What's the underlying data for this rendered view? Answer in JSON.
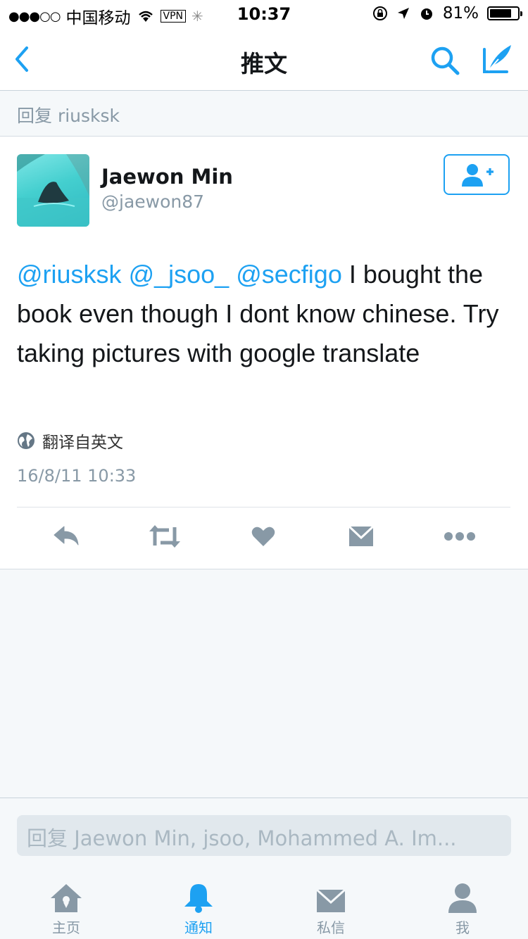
{
  "status_bar": {
    "signal": "●●●○○",
    "carrier": "中国移动",
    "vpn": "VPN",
    "time": "10:37",
    "battery_text": "81%",
    "battery_level": 0.81
  },
  "nav": {
    "title": "推文",
    "accent": "#1da1f2"
  },
  "reply_banner": "回复 riusksk",
  "tweet": {
    "author_name": "Jaewon Min",
    "author_handle": "@jaewon87",
    "mentions": [
      "@riusksk",
      "@_jsoo_",
      "@secfigo"
    ],
    "body": "I bought the book even though I dont know chinese. Try taking pictures with google translate",
    "translate_label": "翻译自英文",
    "timestamp": "16/8/11 10:33"
  },
  "icons": {
    "back": "chevron-left-icon",
    "search": "search-icon",
    "compose": "compose-icon",
    "follow": "add-user-icon",
    "globe": "globe-icon",
    "reply": "reply-icon",
    "retweet": "retweet-icon",
    "like": "heart-icon",
    "dm": "envelope-icon",
    "more": "more-icon"
  },
  "reply_input": {
    "placeholder": "回复 Jaewon Min, jsoo, Mohammed A. Im..."
  },
  "tabs": [
    {
      "label": "主页",
      "icon": "home-icon",
      "active": false
    },
    {
      "label": "通知",
      "icon": "bell-icon",
      "active": true
    },
    {
      "label": "私信",
      "icon": "envelope-icon",
      "active": false
    },
    {
      "label": "我",
      "icon": "profile-icon",
      "active": false
    }
  ]
}
